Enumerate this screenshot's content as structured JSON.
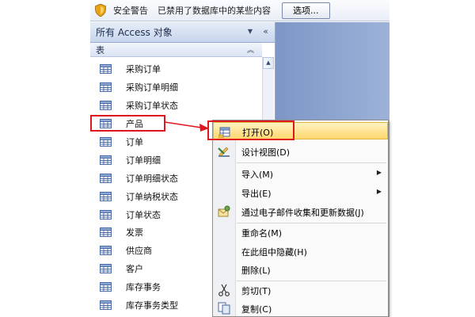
{
  "security_bar": {
    "title": "安全警告",
    "message": "已禁用了数据库中的某些内容",
    "options_button": "选项..."
  },
  "nav_pane": {
    "title": "所有 Access 对象",
    "group_title": "表",
    "items": [
      {
        "label": "采购订单"
      },
      {
        "label": "采购订单明细"
      },
      {
        "label": "采购订单状态"
      },
      {
        "label": "产品"
      },
      {
        "label": "订单"
      },
      {
        "label": "订单明细"
      },
      {
        "label": "订单明细状态"
      },
      {
        "label": "订单纳税状态"
      },
      {
        "label": "订单状态"
      },
      {
        "label": "发票"
      },
      {
        "label": "供应商"
      },
      {
        "label": "客户"
      },
      {
        "label": "库存事务"
      },
      {
        "label": "库存事务类型"
      }
    ],
    "selected_item": "产品"
  },
  "context_menu": {
    "items": [
      {
        "label": "打开(O)",
        "icon": "open-table-icon",
        "highlighted": true
      },
      {
        "label": "设计视图(D)",
        "icon": "design-view-icon"
      },
      {
        "label": "导入(M)",
        "submenu": true
      },
      {
        "label": "导出(E)",
        "submenu": true
      },
      {
        "label": "通过电子邮件收集和更新数据(J)",
        "icon": "email-collect-icon"
      },
      {
        "label": "重命名(M)"
      },
      {
        "label": "在此组中隐藏(H)"
      },
      {
        "label": "删除(L)"
      },
      {
        "label": "剪切(T)",
        "icon": "scissors-icon"
      },
      {
        "label": "复制(C)",
        "icon": "copy-icon"
      }
    ]
  },
  "colors": {
    "annotation_red": "#e0161e",
    "workspace_blue": "#8aa2cf",
    "menu_highlight": "#ffd76d"
  }
}
